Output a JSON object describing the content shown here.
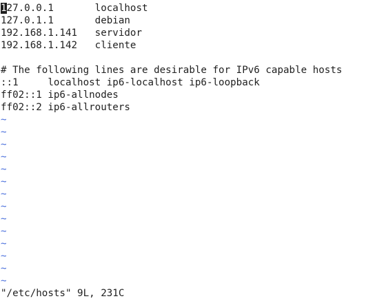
{
  "file_lines": [
    {
      "first": "1",
      "rest": "27.0.0.1       localhost"
    },
    {
      "text": "127.0.1.1       debian"
    },
    {
      "text": "192.168.1.141   servidor"
    },
    {
      "text": "192.168.1.142   cliente"
    },
    {
      "text": ""
    },
    {
      "text": "# The following lines are desirable for IPv6 capable hosts"
    },
    {
      "text": "::1     localhost ip6-localhost ip6-loopback"
    },
    {
      "text": "ff02::1 ip6-allnodes"
    },
    {
      "text": "ff02::2 ip6-allrouters"
    }
  ],
  "empty_line_marker": "~",
  "status_line": "\"/etc/hosts\" 9L, 231C",
  "colors": {
    "text": "#1f1f1f",
    "tilde": "#4a6fdc",
    "background": "#ffffff"
  }
}
